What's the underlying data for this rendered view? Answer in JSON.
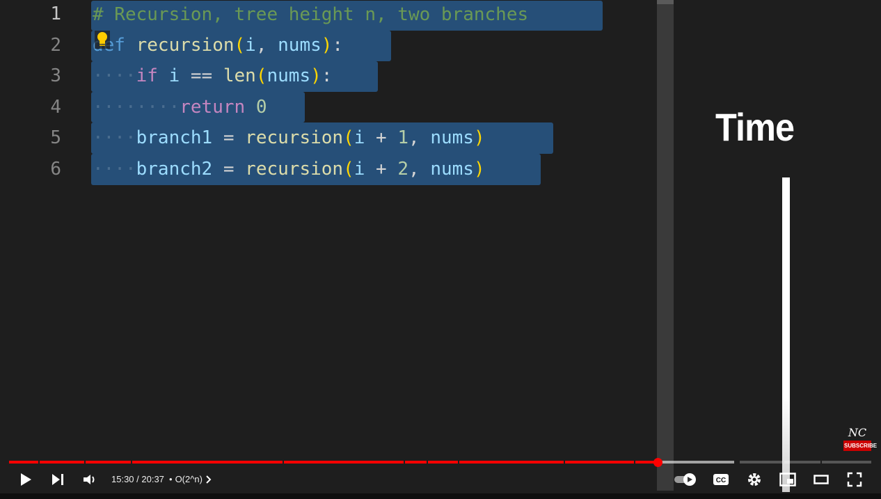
{
  "editor": {
    "line_numbers": [
      "1",
      "2",
      "3",
      "4",
      "5",
      "6"
    ]
  },
  "overlay": {
    "time_label": "Time"
  },
  "watermark": {
    "logo": "NC",
    "subscribe_label": "SUBSCRIBE"
  },
  "player": {
    "current_time": "15:30",
    "duration": "20:37",
    "time_text": "15:30 / 20:37",
    "chapter_title": "O(2^n)",
    "progress_fraction": 0.752,
    "accent_color": "#ff0000"
  },
  "controls": {
    "icons": [
      "play-icon",
      "next-icon",
      "volume-icon",
      "autoplay-toggle-icon",
      "captions-icon",
      "settings-icon",
      "miniplayer-icon",
      "theater-icon",
      "fullscreen-icon"
    ],
    "captions_label": "CC"
  }
}
